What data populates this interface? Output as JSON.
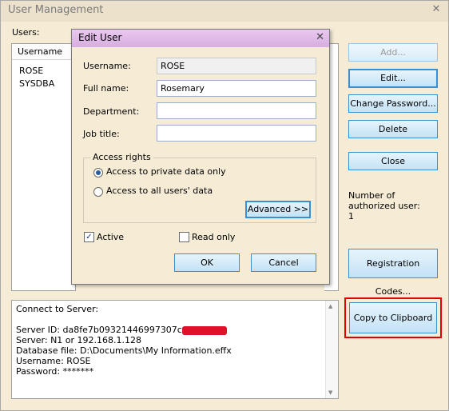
{
  "window": {
    "title": "User Management",
    "close_glyph": "✕"
  },
  "users": {
    "label": "Users:",
    "column_header": "Username",
    "rows": [
      "ROSE",
      "SYSDBA"
    ]
  },
  "buttons": {
    "add": "Add...",
    "edit": "Edit...",
    "change_password": "Change Password...",
    "delete": "Delete",
    "close": "Close",
    "registration_codes": "Registration Codes...",
    "copy_to_clipboard": "Copy to Clipboard"
  },
  "authorized": {
    "label": "Number of authorized user:",
    "value": "1"
  },
  "info": {
    "line1": "Connect to Server:",
    "server_id": "Server ID: da8fe7b09321446997307c",
    "server": "Server: N1 or 192.168.1.128",
    "database_file": "Database file: D:\\Documents\\My Information.effx",
    "username": "Username: ROSE",
    "password": "Password: *******"
  },
  "dialog": {
    "title": "Edit User",
    "close_glyph": "✕",
    "username_label": "Username:",
    "username_value": "ROSE",
    "fullname_label": "Full name:",
    "fullname_value": "Rosemary",
    "department_label": "Department:",
    "department_value": "",
    "jobtitle_label": "Job title:",
    "jobtitle_value": "",
    "access_rights_label": "Access rights",
    "radio_private": "Access to private data only",
    "radio_all": "Access to all users' data",
    "advanced_button": "Advanced >>",
    "active_label": "Active",
    "readonly_label": "Read only",
    "ok_button": "OK",
    "cancel_button": "Cancel",
    "check_glyph": "✓"
  },
  "colors": {
    "background": "#f6ecd6",
    "dialog_title": "#d7aee0",
    "button_border": "#3a8fd0",
    "highlight": "#e00000",
    "redaction": "#e0102a"
  }
}
